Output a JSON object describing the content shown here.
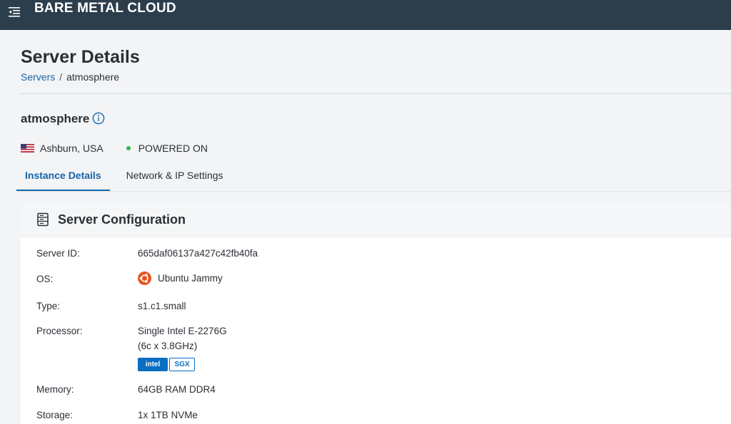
{
  "app": {
    "brand": "BARE METAL CLOUD"
  },
  "page": {
    "title": "Server Details",
    "breadcrumb": {
      "parent": "Servers",
      "separator": "/",
      "current": "atmosphere"
    }
  },
  "server": {
    "name": "atmosphere",
    "location": "Ashburn, USA",
    "status": "POWERED ON",
    "status_color": "#39b54a"
  },
  "tabs": [
    {
      "label": "Instance Details",
      "active": true
    },
    {
      "label": "Network & IP Settings",
      "active": false
    }
  ],
  "config": {
    "title": "Server Configuration",
    "rows": {
      "server_id": {
        "label": "Server ID:",
        "value": "665daf06137a427c42fb40fa"
      },
      "os": {
        "label": "OS:",
        "value": "Ubuntu Jammy"
      },
      "type": {
        "label": "Type:",
        "value": "s1.c1.small"
      },
      "processor": {
        "label": "Processor:",
        "value_line1": "Single Intel E-2276G",
        "value_line2": "(6c x 3.8GHz)",
        "badge_intel": "intel",
        "badge_sgx": "SGX"
      },
      "memory": {
        "label": "Memory:",
        "value": "64GB RAM DDR4"
      },
      "storage": {
        "label": "Storage:",
        "value": "1x 1TB NVMe"
      }
    }
  },
  "colors": {
    "topbar": "#2c3e4c",
    "accent": "#1565a8",
    "ubuntu": "#e95420",
    "intel": "#0a6fc2"
  },
  "icons": {
    "menu": "menu-collapse-icon",
    "info": "info-circle-icon",
    "flag": "us-flag-icon",
    "server": "server-icon",
    "os": "ubuntu-logo-icon"
  }
}
